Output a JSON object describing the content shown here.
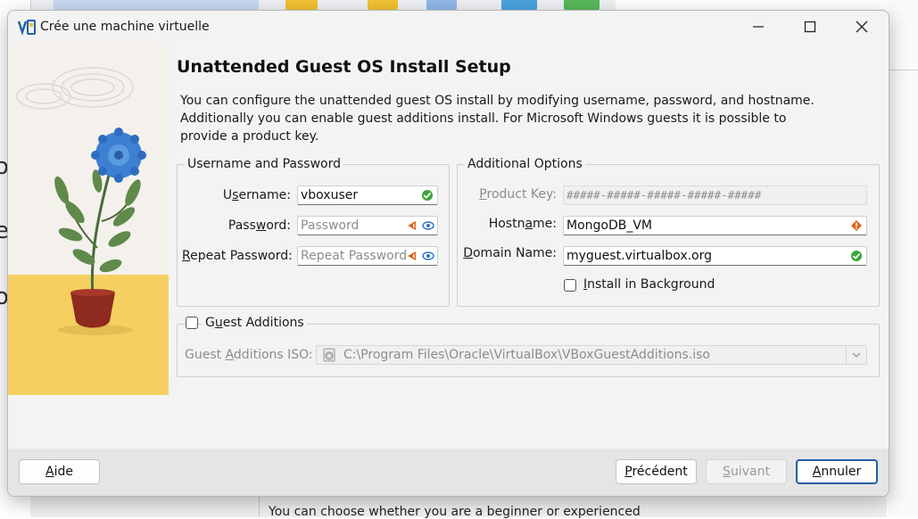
{
  "window": {
    "title": "Crée une machine virtuelle"
  },
  "page": {
    "heading": "Unattended Guest OS Install Setup",
    "description": "You can configure the unattended guest OS install by modifying username, password, and hostname. Additionally you can enable guest additions install. For Microsoft Windows guests it is possible to provide a product key."
  },
  "username_password": {
    "title": "Username and Password",
    "username": {
      "label_pre": "U",
      "label_key": "s",
      "label_post": "ername:",
      "value": "vboxuser"
    },
    "password": {
      "label_pre": "Pass",
      "label_key": "w",
      "label_post": "ord:",
      "placeholder": "Password",
      "value": ""
    },
    "repeat_password": {
      "label_pre": "",
      "label_key": "R",
      "label_post": "epeat Password:",
      "placeholder": "Repeat Password",
      "value": ""
    }
  },
  "additional_options": {
    "title": "Additional Options",
    "product_key": {
      "label_pre": "",
      "label_key": "P",
      "label_post": "roduct Key:",
      "value": "#####-#####-#####-#####-#####"
    },
    "hostname": {
      "label_pre": "Hostn",
      "label_key": "a",
      "label_post": "me:",
      "value": "MongoDB_VM"
    },
    "domain_name": {
      "label_pre": "",
      "label_key": "D",
      "label_post": "omain Name:",
      "value": "myguest.virtualbox.org"
    },
    "install_background": {
      "label_pre": "",
      "label_key": "I",
      "label_post": "nstall in Background",
      "checked": false
    }
  },
  "guest_additions": {
    "checkbox": {
      "label_pre": "G",
      "label_key": "u",
      "label_post": "est Additions",
      "checked": false
    },
    "iso": {
      "label_pre": "Guest ",
      "label_key": "A",
      "label_post": "dditions ISO:",
      "value": "C:\\Program Files\\Oracle\\VirtualBox\\VBoxGuestAdditions.iso"
    }
  },
  "footer": {
    "help": {
      "key": "A",
      "rest": "ide"
    },
    "back": {
      "pre": "",
      "key": "P",
      "rest": "récédent"
    },
    "next": {
      "pre": "",
      "key": "S",
      "rest": "uivant"
    },
    "cancel": {
      "pre": "",
      "key": "A",
      "rest": "nnuler"
    }
  },
  "background": {
    "bottom_text": "You can choose whether you are a beginner or experienced"
  },
  "colors": {
    "accent": "#1f5fa8",
    "valid": "#3aa63a",
    "warning": "#e0651a",
    "eye": "#2a6fc4"
  },
  "icons": {
    "valid": "check-icon",
    "warning": "warning-icon",
    "reveal": "eye-icon",
    "iso": "disc-icon",
    "dropdown": "chevron-down-icon"
  }
}
